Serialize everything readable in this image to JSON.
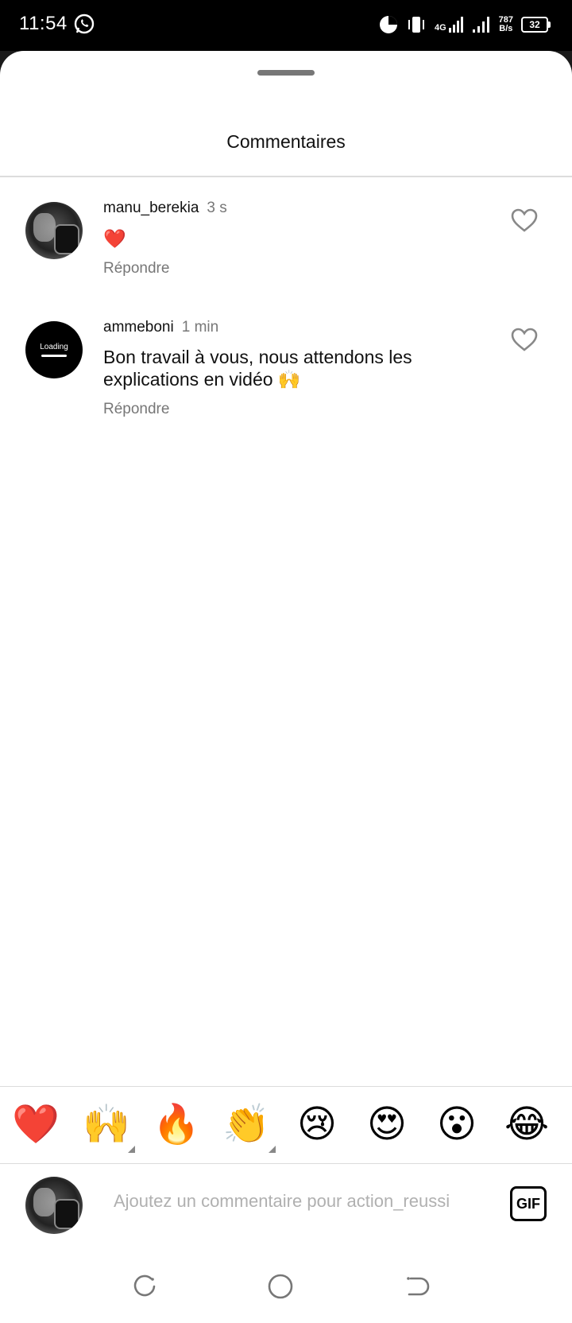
{
  "status_bar": {
    "time": "11:54",
    "network_type": "4G",
    "speed_value": "787",
    "speed_unit": "B/s",
    "battery": "32"
  },
  "sheet": {
    "title": "Commentaires"
  },
  "comments": [
    {
      "username": "manu_berekia",
      "time": "3 s",
      "text": "❤️",
      "reply_label": "Répondre"
    },
    {
      "username": "ammeboni",
      "time": "1 min",
      "text": "Bon travail à vous, nous attendons les explications en vidéo 🙌",
      "reply_label": "Répondre",
      "avatar_text": "Loading"
    }
  ],
  "quick_emojis": [
    "❤️",
    "🙌",
    "🔥",
    "👏",
    "😢",
    "😍",
    "😮",
    "😂"
  ],
  "composer": {
    "placeholder": "Ajoutez un commentaire pour action_reussi",
    "gif_label": "GIF"
  },
  "colors": {
    "text_primary": "#111111",
    "text_secondary": "#777777",
    "placeholder": "#b0b0b0",
    "divider": "#dcdcdc"
  }
}
